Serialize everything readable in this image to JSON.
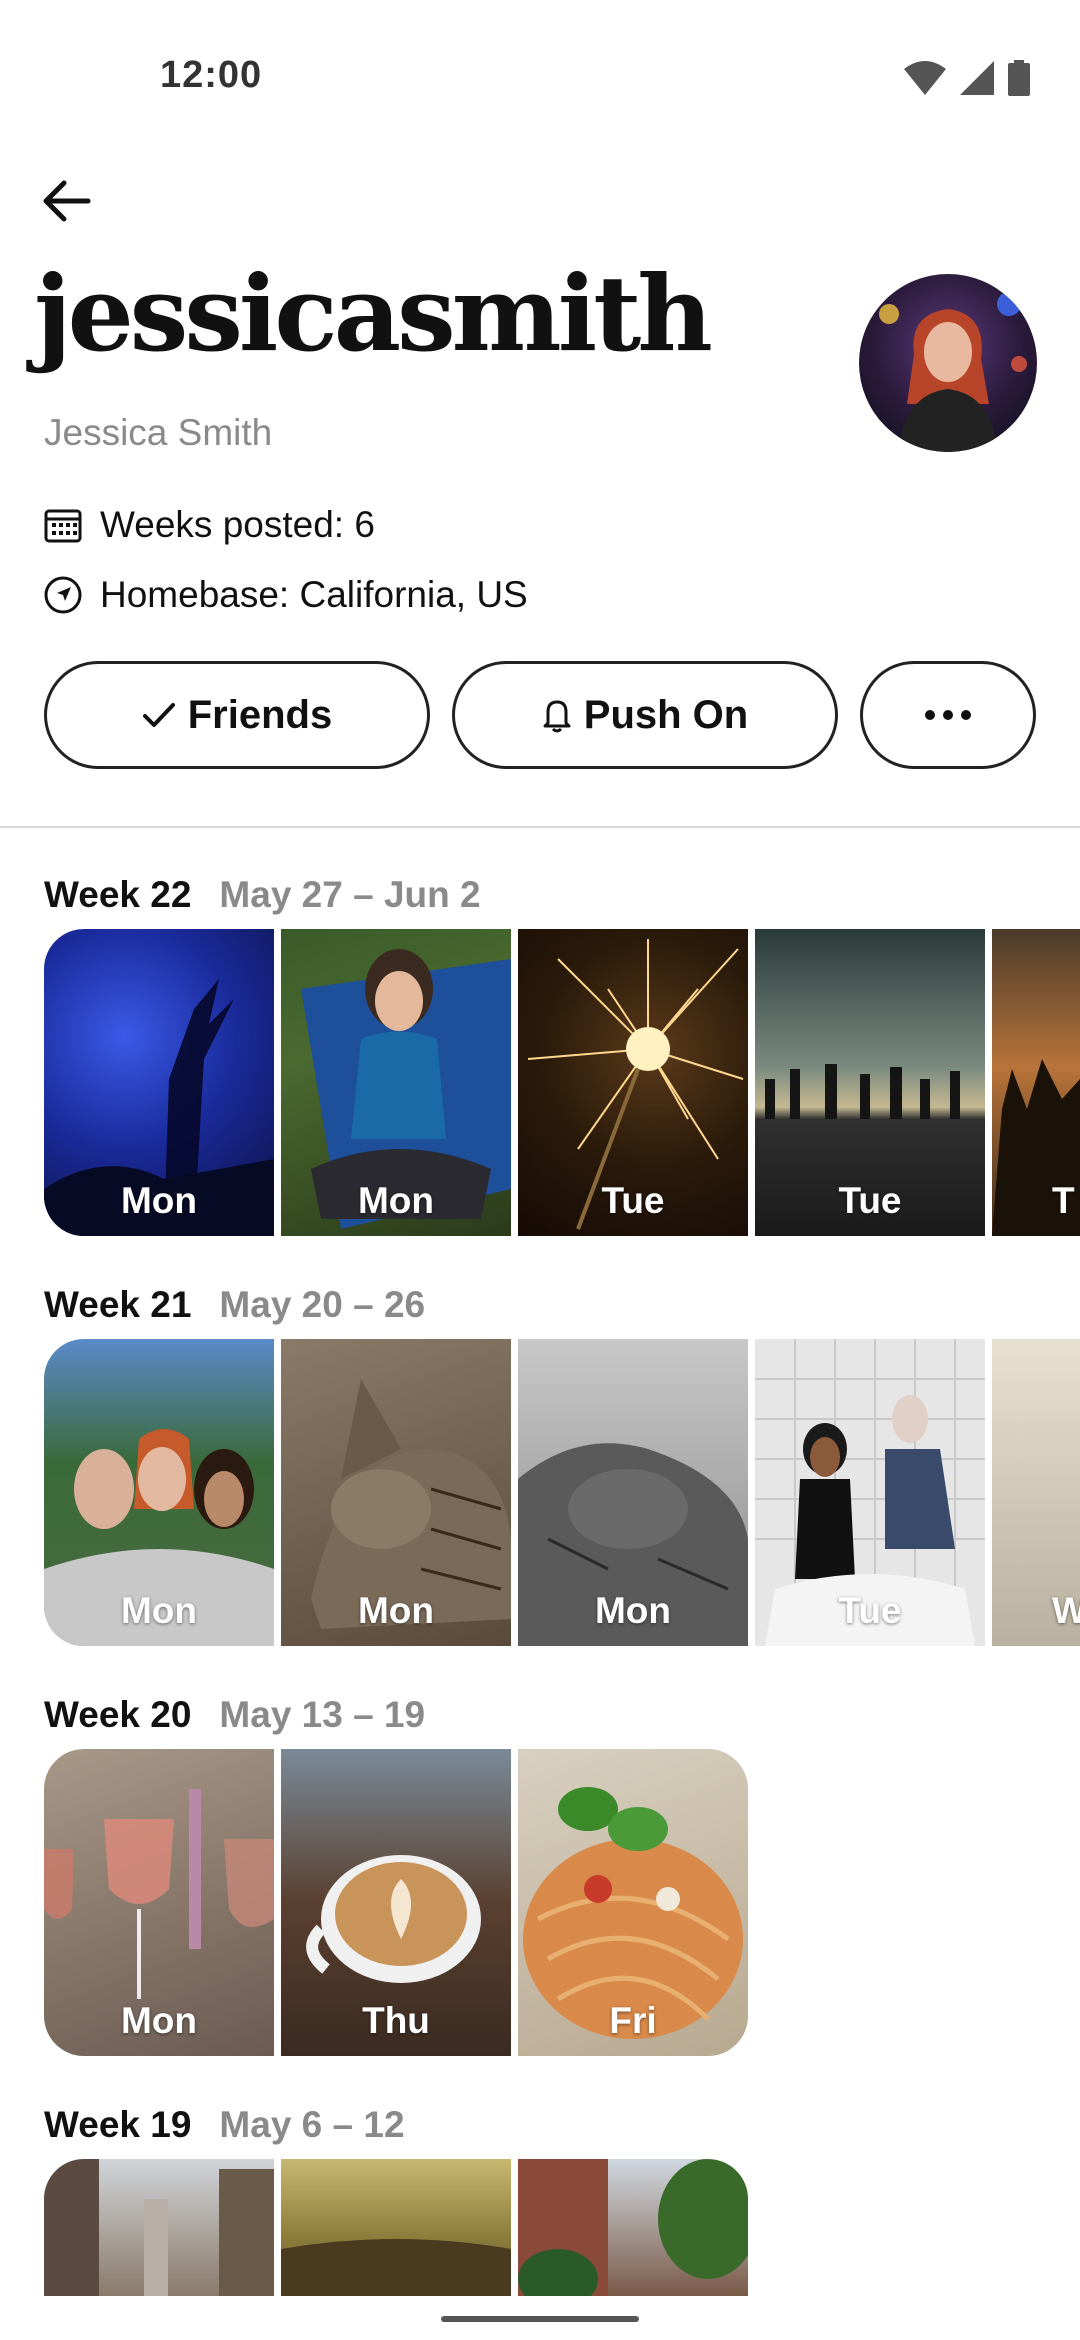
{
  "status_bar": {
    "time": "12:00"
  },
  "profile": {
    "username": "jessicasmith",
    "display_name": "Jessica Smith",
    "weeks_posted": "Weeks posted: 6",
    "homebase": "Homebase: California, US"
  },
  "actions": {
    "friends_label": "Friends",
    "push_label": "Push On"
  },
  "weeks": [
    {
      "title": "Week 22",
      "range": "May 27 – Jun 2",
      "days": [
        "Mon",
        "Mon",
        "Tue",
        "Tue",
        "T"
      ]
    },
    {
      "title": "Week 21",
      "range": "May 20 – 26",
      "days": [
        "Mon",
        "Mon",
        "Mon",
        "Tue",
        "W"
      ]
    },
    {
      "title": "Week 20",
      "range": "May 13 – 19",
      "days": [
        "Mon",
        "Thu",
        "Fri"
      ]
    },
    {
      "title": "Week 19",
      "range": "May 6 – 12",
      "days": [
        "",
        "",
        ""
      ]
    }
  ],
  "colors": {
    "text": "#111111",
    "muted": "#8a8a8a",
    "border": "#222222"
  },
  "icons": [
    "back-arrow-icon",
    "calendar-icon",
    "navigation-icon",
    "check-icon",
    "bell-icon",
    "more-icon"
  ]
}
